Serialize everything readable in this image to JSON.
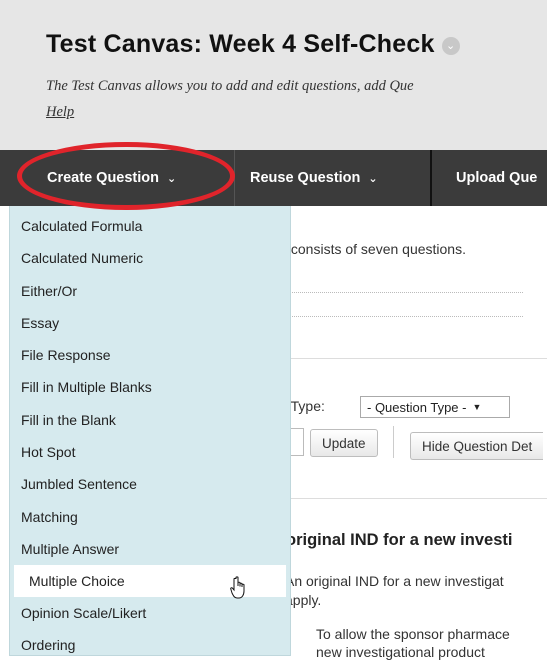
{
  "header": {
    "title": "Test Canvas: Week 4 Self-Check",
    "description": "The Test Canvas allows you to add and edit questions, add Que",
    "help_link": "Help"
  },
  "toolbar": {
    "create_label": "Create Question",
    "reuse_label": "Reuse Question",
    "upload_label": "Upload Que"
  },
  "dropdown": {
    "items": [
      "Calculated Formula",
      "Calculated Numeric",
      "Either/Or",
      "Essay",
      "File Response",
      "Fill in Multiple Blanks",
      "Fill in the Blank",
      "Hot Spot",
      "Jumbled Sentence",
      "Matching",
      "Multiple Answer",
      "Multiple Choice",
      "Opinion Scale/Likert",
      "Ordering"
    ],
    "selected": "Multiple Choice"
  },
  "content": {
    "intro_text": "k consists of seven questions.",
    "filter_label": "y Type:",
    "question_type_select": "- Question Type -",
    "update_button": "Update",
    "hide_details_button": "Hide Question Det",
    "question_title": "original IND for a new investi",
    "question_text_1": "An original IND for a new investigat",
    "question_text_2": "apply.",
    "answer_text_1": "To allow the sponsor pharmace",
    "answer_text_2": "new investigational product"
  },
  "colors": {
    "toolbar_bg": "#3b3b3b",
    "header_bg": "#e6e6e6",
    "dropdown_bg": "#d6eaee",
    "highlight": "#e0242b"
  }
}
